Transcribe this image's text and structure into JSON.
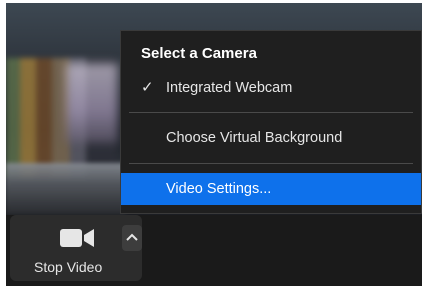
{
  "camera_menu": {
    "heading": "Select a Camera",
    "items": [
      {
        "label": "Integrated Webcam",
        "checked": true,
        "icon": "check-icon"
      },
      {
        "label": "Choose Virtual Background",
        "checked": false
      },
      {
        "label": "Video Settings...",
        "highlighted": true
      }
    ]
  },
  "toolbar": {
    "stop_video_label": "Stop Video",
    "stop_video_icon": "video-camera-icon",
    "options_icon": "chevron-up-icon"
  },
  "colors": {
    "highlight": "#0e71eb",
    "menu_background": "#1f1f1f",
    "toolbar_background": "#1a1a1a"
  }
}
